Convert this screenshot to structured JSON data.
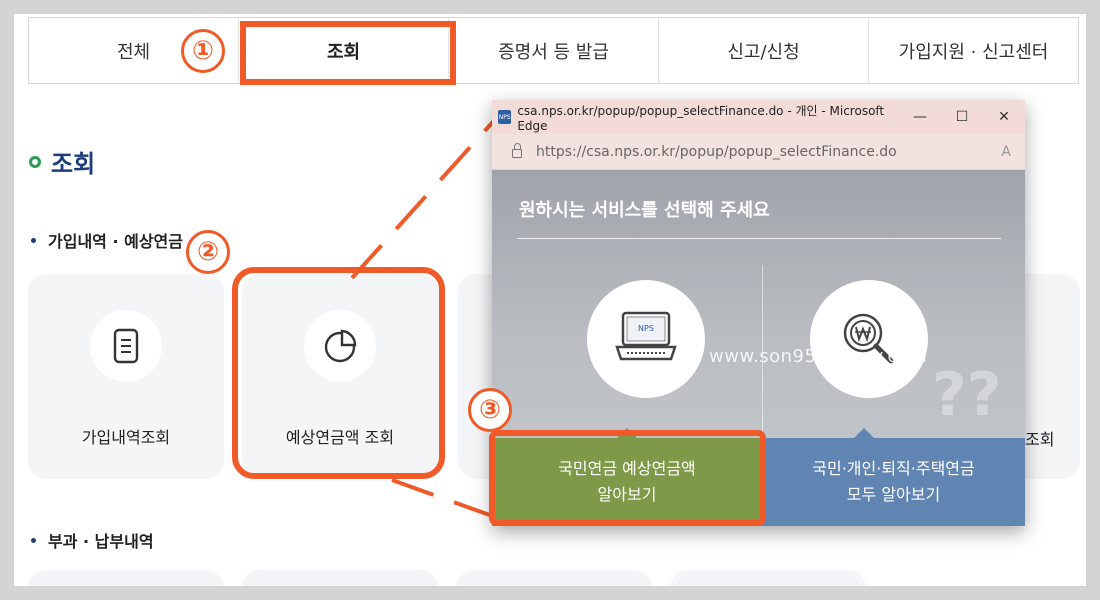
{
  "tabs": [
    "전체",
    "조회",
    "증명서 등 발급",
    "신고/신청",
    "가입지원 · 신고센터"
  ],
  "annotations": [
    "①",
    "②",
    "③"
  ],
  "section": {
    "title": "조회"
  },
  "subsections": [
    "가입내역 · 예상연금",
    "부과 · 납부내역"
  ],
  "cards": [
    {
      "label": "가입내역조회",
      "icon": "document-icon"
    },
    {
      "label": "예상연금액 조회",
      "icon": "pie-chart-icon"
    }
  ],
  "partial_card_label": "조회",
  "popup": {
    "window_title": "csa.nps.or.kr/popup/popup_selectFinance.do - 개인 - Microsoft Edge",
    "favicon": "NPS",
    "url": "https://csa.nps.or.kr/popup/popup_selectFinance.do",
    "read_aloud": "A",
    "heading": "원하시는 서비스를 선택해 주세요",
    "watermark": "www.son95.tistory.com",
    "laptop_badge": "NPS",
    "option1_line1": "국민연금 예상연금액",
    "option1_line2": "알아보기",
    "option2_line1": "국민·개인·퇴직·주택연금",
    "option2_line2": "모두 알아보기"
  },
  "colors": {
    "annotation": "#f05a28",
    "option1": "#7e9a49",
    "option2": "#6185b3",
    "title": "#1d3c78"
  }
}
